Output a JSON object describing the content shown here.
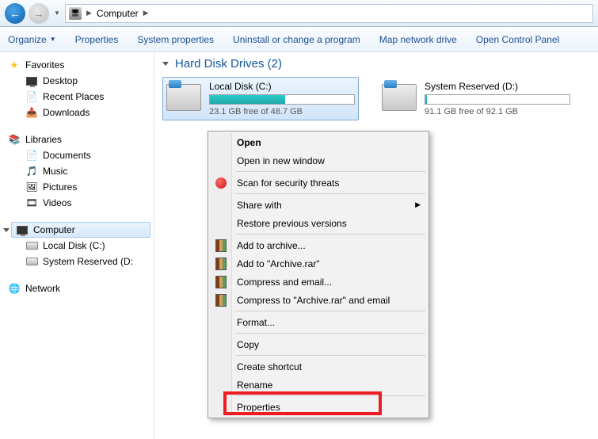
{
  "nav": {
    "crumb1": "Computer"
  },
  "toolbar": {
    "organize": "Organize",
    "properties": "Properties",
    "system_properties": "System properties",
    "uninstall": "Uninstall or change a program",
    "map_drive": "Map network drive",
    "control_panel": "Open Control Panel"
  },
  "sidebar": {
    "favorites": {
      "label": "Favorites",
      "items": [
        "Desktop",
        "Recent Places",
        "Downloads"
      ]
    },
    "libraries": {
      "label": "Libraries",
      "items": [
        "Documents",
        "Music",
        "Pictures",
        "Videos"
      ]
    },
    "computer": {
      "label": "Computer",
      "items": [
        "Local Disk (C:)",
        "System Reserved (D:"
      ]
    },
    "network": {
      "label": "Network"
    }
  },
  "content": {
    "section_title": "Hard Disk Drives (2)",
    "drives": [
      {
        "name": "Local Disk (C:)",
        "free_text": "23.1 GB free of 48.7 GB",
        "fill_pct": 52
      },
      {
        "name": "System Reserved (D:)",
        "free_text": "91.1 GB free of 92.1 GB",
        "fill_pct": 1
      }
    ]
  },
  "context_menu": {
    "open": "Open",
    "open_new": "Open in new window",
    "scan": "Scan for security threats",
    "share": "Share with",
    "restore": "Restore previous versions",
    "add_archive": "Add to archive...",
    "add_rar": "Add to \"Archive.rar\"",
    "compress_email": "Compress and email...",
    "compress_rar_email": "Compress to \"Archive.rar\" and email",
    "format": "Format...",
    "copy": "Copy",
    "create_shortcut": "Create shortcut",
    "rename": "Rename",
    "properties": "Properties"
  }
}
